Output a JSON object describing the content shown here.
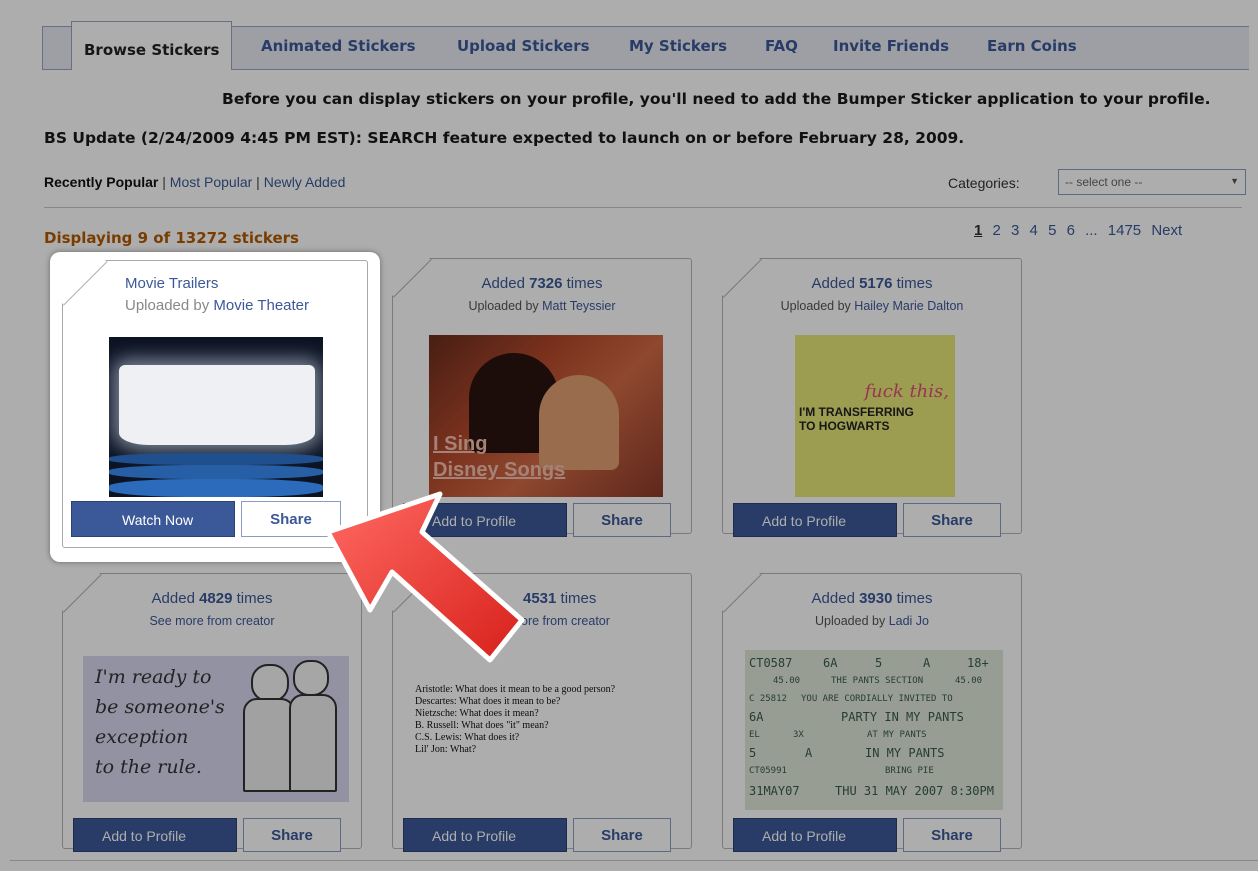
{
  "tabs": [
    {
      "label": "Browse Stickers",
      "active": true
    },
    {
      "label": "Animated Stickers"
    },
    {
      "label": "Upload Stickers"
    },
    {
      "label": "My Stickers"
    },
    {
      "label": "FAQ"
    },
    {
      "label": "Invite Friends"
    },
    {
      "label": "Earn Coins"
    }
  ],
  "notice": "Before you can display stickers on your profile, you'll need to add the Bumper Sticker application to your profile.",
  "update": "BS Update (2/24/2009 4:45 PM EST): SEARCH feature expected to launch on or before February 28, 2009.",
  "filters": {
    "recently_popular": "Recently Popular",
    "sep": "|",
    "most_popular": "Most Popular",
    "newly_added": "Newly Added"
  },
  "categories": {
    "label": "Categories:",
    "selected": "-- select one --"
  },
  "displaying": "Displaying 9 of 13272 stickers",
  "pager": {
    "current": "1",
    "pages": [
      "2",
      "3",
      "4",
      "5",
      "6",
      "..."
    ],
    "last": "1475",
    "next": "Next"
  },
  "featured": {
    "title": "Movie Trailers",
    "uploaded_by_label": "Uploaded by",
    "uploader": "Movie Theater",
    "primary_button": "Watch Now",
    "share_button": "Share"
  },
  "cards": [
    {
      "added_prefix": "Added",
      "count": "7326",
      "added_suffix": "times",
      "sub_label": "Uploaded by",
      "sub_who": "Matt Teyssier",
      "button": "Add to Profile",
      "share": "Share",
      "image_text": [
        "I Sing",
        "Disney Songs"
      ]
    },
    {
      "added_prefix": "Added",
      "count": "5176",
      "added_suffix": "times",
      "sub_label": "Uploaded by",
      "sub_who": "Hailey Marie Dalton",
      "button": "Add to Profile",
      "share": "Share",
      "image_text": [
        "fuck this,",
        "I'M TRANSFERRING",
        "TO HOGWARTS"
      ]
    },
    {
      "added_prefix": "Added",
      "count": "4829",
      "added_suffix": "times",
      "sub_label": "See more from creator",
      "sub_who": "",
      "button": "Add to Profile",
      "share": "Share",
      "image_text": [
        "I'm ready to",
        "be someone's",
        "exception",
        "to the rule."
      ]
    },
    {
      "added_prefix": "",
      "count": "4531",
      "added_suffix": "times",
      "sub_label": "ore from creator",
      "sub_who": "",
      "button": "Add to Profile",
      "share": "Share",
      "image_text": [
        "Aristotle: What does it mean to be a good person?",
        "Descartes: What does it mean to be?",
        "Nietzsche: What does it mean?",
        "B. Russell: What does \"it\" mean?",
        "C.S. Lewis: What does it?",
        "Lil' Jon: What?"
      ]
    },
    {
      "added_prefix": "Added",
      "count": "3930",
      "added_suffix": "times",
      "sub_label": "Uploaded by",
      "sub_who": "Ladi Jo",
      "button": "Add to Profile",
      "share": "Share",
      "image_text": [
        "CT0587",
        "6A",
        "5",
        "A",
        "18+",
        "45.00",
        "THE PANTS SECTION",
        "45.00",
        "C 25812",
        "YOU ARE CORDIALLY INVITED TO",
        "6A",
        "PARTY IN MY PANTS",
        "EL",
        "3X",
        "AT MY PANTS",
        "5",
        "A",
        "IN MY PANTS",
        "CT05991",
        "BRING PIE",
        "31MAY07",
        "THU 31 MAY 2007 8:30PM"
      ]
    }
  ]
}
